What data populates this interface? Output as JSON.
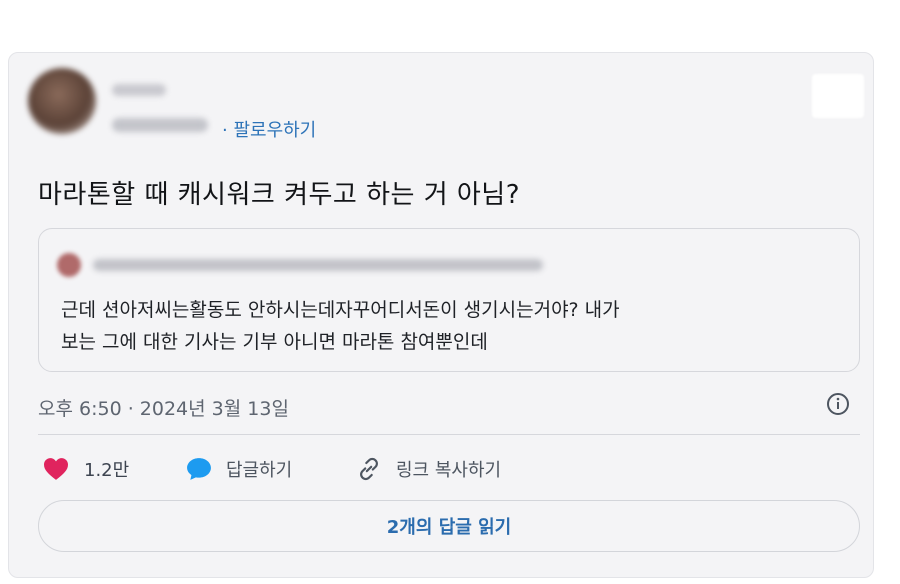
{
  "post": {
    "follow_label": "· 팔로우하기",
    "text": "마라톤할 때 캐시워크 켜두고 하는 거 아님?"
  },
  "quoted": {
    "line1": "근데 션아저씨는활동도 안하시는데자꾸어디서돈이 생기시는거야? 내가",
    "line2": "보는 그에 대한 기사는 기부 아니면 마라톤 참여뿐인데"
  },
  "meta": {
    "timestamp": "오후 6:50 · 2024년 3월 13일"
  },
  "actions": {
    "likes": "1.2만",
    "reply_label": "답글하기",
    "copy_link_label": "링크 복사하기"
  },
  "read_replies_label": "2개의 답글 읽기",
  "colors": {
    "like": "#e0245e",
    "reply": "#1d9bf0",
    "link": "#2d73b8",
    "card_bg": "#f4f4f6"
  },
  "icons": [
    "heart-icon",
    "reply-bubble-icon",
    "link-icon",
    "info-icon"
  ]
}
